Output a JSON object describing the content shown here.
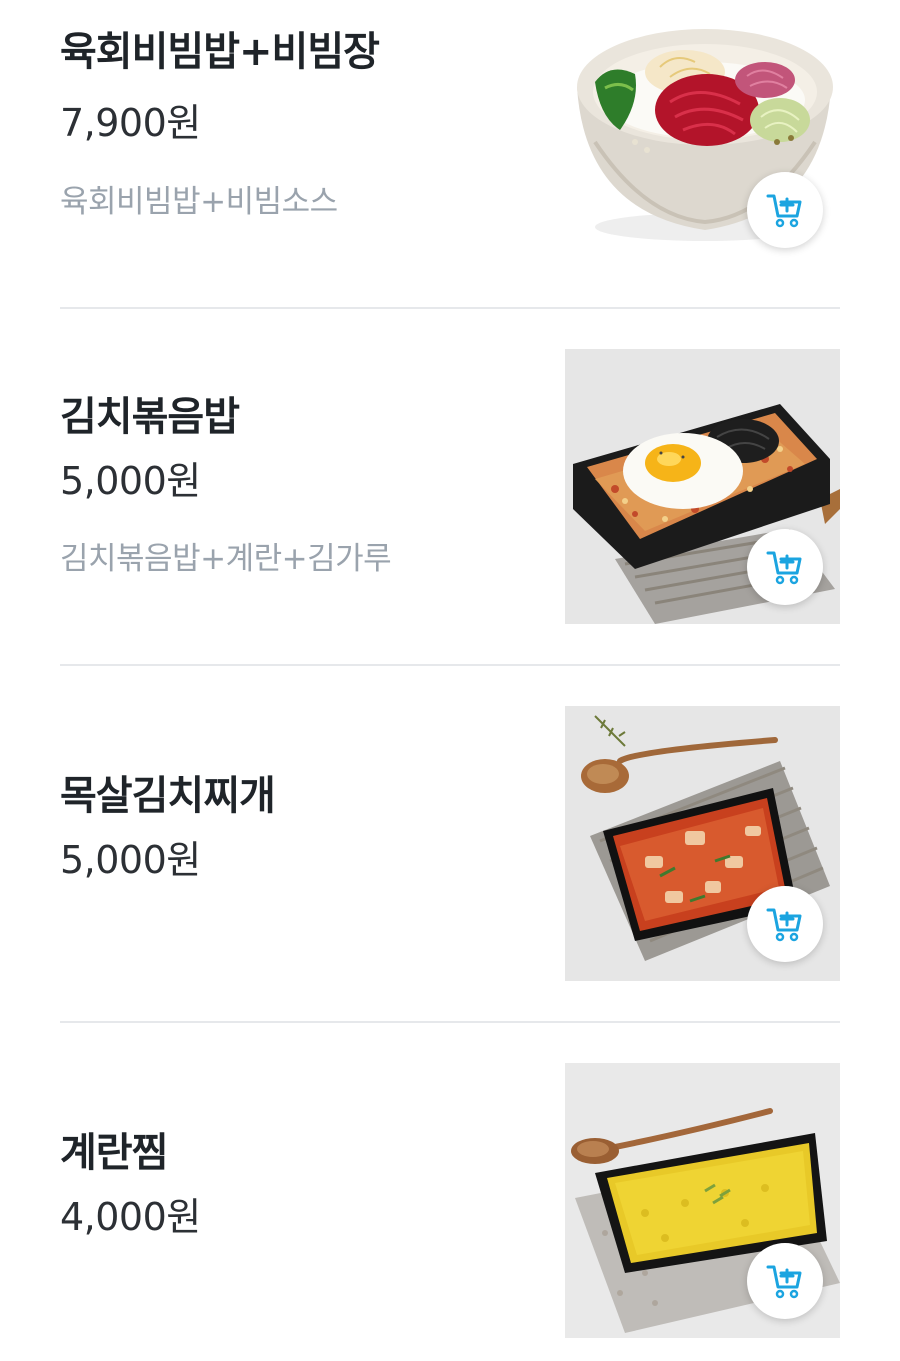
{
  "accent_color": "#1ba4e0",
  "menu_items": [
    {
      "name": "육회비빔밥+비빔장",
      "price": "7,900원",
      "description": "육회비빔밥+비빔소스",
      "image": "bibimbap-bowl",
      "cart_icon": "add-to-cart-icon"
    },
    {
      "name": "김치볶음밥",
      "price": "5,000원",
      "description": "김치볶음밥+계란+김가루",
      "image": "kimchi-fried-rice-tray",
      "cart_icon": "add-to-cart-icon"
    },
    {
      "name": "목살김치찌개",
      "price": "5,000원",
      "image": "kimchi-stew-tray",
      "cart_icon": "add-to-cart-icon"
    },
    {
      "name": "계란찜",
      "price": "4,000원",
      "image": "steamed-egg-tray",
      "cart_icon": "add-to-cart-icon"
    }
  ]
}
